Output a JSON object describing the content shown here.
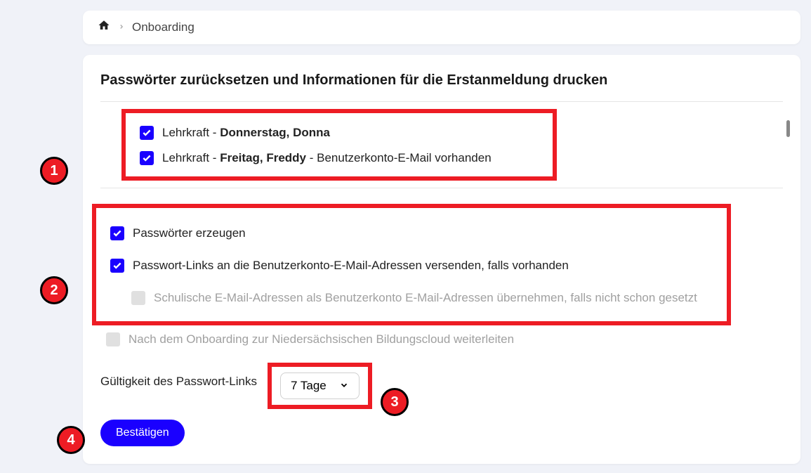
{
  "breadcrumb": {
    "current": "Onboarding"
  },
  "heading": "Passwörter zurücksetzen und Informationen für die Erstanmeldung drucken",
  "users": [
    {
      "role_prefix": "Lehrkraft - ",
      "name": "Donnerstag, Donna",
      "suffix": ""
    },
    {
      "role_prefix": "Lehrkraft - ",
      "name": "Freitag, Freddy",
      "suffix": " - Benutzerkonto-E-Mail vorhanden"
    }
  ],
  "options": {
    "generate_passwords": "Passwörter erzeugen",
    "send_links": "Passwort-Links an die Benutzerkonto-E-Mail-Adressen versenden, falls vorhanden",
    "adopt_school_email": "Schulische E-Mail-Adressen als Benutzerkonto E-Mail-Adressen übernehmen, falls nicht schon gesetzt",
    "redirect_nbc": "Nach dem Onboarding zur Niedersächsischen Bildungscloud weiterleiten"
  },
  "validity": {
    "label": "Gültigkeit des Passwort-Links",
    "value": "7 Tage"
  },
  "confirm": "Bestätigen",
  "badges": [
    "1",
    "2",
    "3",
    "4"
  ]
}
